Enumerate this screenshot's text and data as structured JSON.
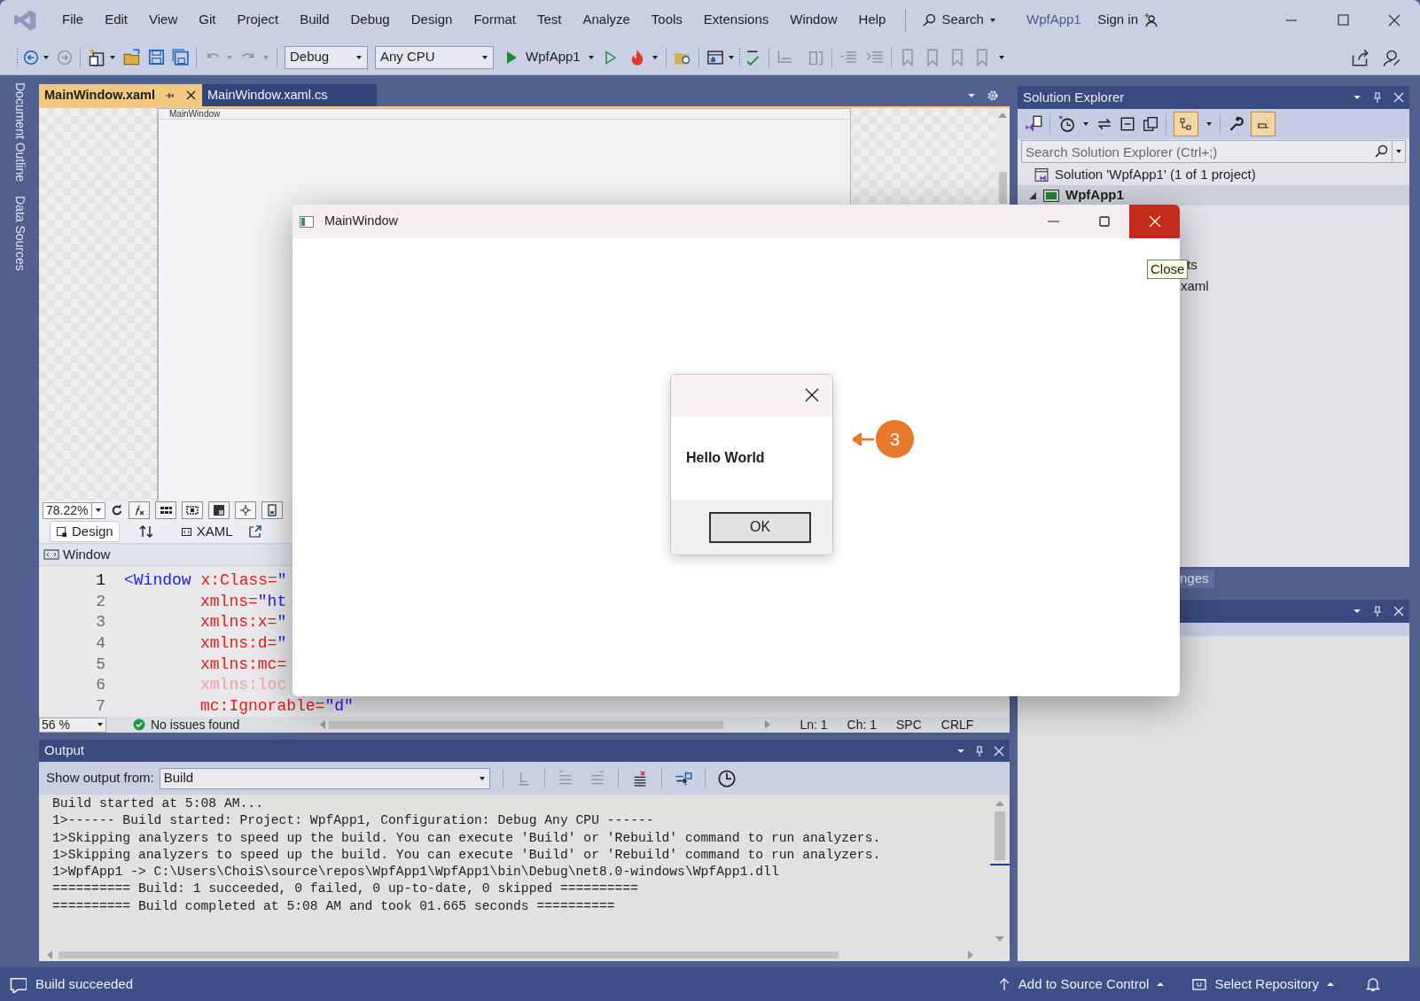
{
  "title_bar": {
    "menus": [
      "File",
      "Edit",
      "View",
      "Git",
      "Project",
      "Build",
      "Debug",
      "Design",
      "Format",
      "Test",
      "Analyze",
      "Tools",
      "Extensions",
      "Window",
      "Help"
    ],
    "search": "Search",
    "solution_name": "WpfApp1",
    "sign_in": "Sign in"
  },
  "toolbar": {
    "configuration": "Debug",
    "platform": "Any CPU",
    "start_target": "WpfApp1"
  },
  "side_tabs": [
    "Document Outline",
    "Data Sources"
  ],
  "document_tabs": [
    {
      "label": "MainWindow.xaml",
      "selected": true
    },
    {
      "label": "MainWindow.xaml.cs",
      "selected": false
    }
  ],
  "designer": {
    "frame_title": "MainWindow",
    "zoom": "78.22%",
    "view_tabs": [
      {
        "label": "Design",
        "selected": true
      },
      {
        "label": "XAML",
        "selected": false
      }
    ],
    "breadcrumb": "Window"
  },
  "code": {
    "lines": [
      {
        "number": "1",
        "current": true,
        "indented": false,
        "tokens": [
          {
            "kind": "tag",
            "text": "<Window"
          },
          {
            "kind": "attribute",
            "text": " x:Class="
          },
          {
            "kind": "value",
            "text": "\""
          }
        ]
      },
      {
        "number": "2",
        "current": false,
        "indented": true,
        "tokens": [
          {
            "kind": "attribute",
            "text": "xmlns="
          },
          {
            "kind": "value",
            "text": "\"ht"
          }
        ]
      },
      {
        "number": "3",
        "current": false,
        "indented": true,
        "tokens": [
          {
            "kind": "attribute",
            "text": "xmlns:x="
          },
          {
            "kind": "value",
            "text": "\""
          }
        ]
      },
      {
        "number": "4",
        "current": false,
        "indented": true,
        "tokens": [
          {
            "kind": "attribute",
            "text": "xmlns:d="
          },
          {
            "kind": "value",
            "text": "\""
          }
        ]
      },
      {
        "number": "5",
        "current": false,
        "indented": true,
        "tokens": [
          {
            "kind": "attribute",
            "text": "xmlns:mc="
          }
        ]
      },
      {
        "number": "6",
        "current": false,
        "indented": true,
        "tokens": [
          {
            "kind": "faded",
            "text": "xmlns:loc"
          }
        ]
      },
      {
        "number": "7",
        "current": false,
        "indented": true,
        "tokens": [
          {
            "kind": "attribute",
            "text": "mc:Ignorable="
          },
          {
            "kind": "value",
            "text": "\"d\""
          }
        ]
      }
    ]
  },
  "editor_status": {
    "zoom": "56 %",
    "issues": "No issues found",
    "line": "Ln: 1",
    "column": "Ch: 1",
    "whitespace": "SPC",
    "line_ending": "CRLF"
  },
  "output": {
    "title": "Output",
    "source_label": "Show output from:",
    "source": "Build",
    "lines": [
      "Build started at 5:08 AM...",
      "1>------ Build started: Project: WpfApp1, Configuration: Debug Any CPU ------",
      "1>Skipping analyzers to speed up the build. You can execute 'Build' or 'Rebuild' command to run analyzers.",
      "1>Skipping analyzers to speed up the build. You can execute 'Build' or 'Rebuild' command to run analyzers.",
      "1>WpfApp1 -> C:\\Users\\ChoiS\\source\\repos\\WpfApp1\\WpfApp1\\bin\\Debug\\net8.0-windows\\WpfApp1.dll",
      "========== Build: 1 succeeded, 0 failed, 0 up-to-date, 0 skipped ==========",
      "========== Build completed at 5:08 AM and took 01.665 seconds =========="
    ]
  },
  "solution_explorer": {
    "title": "Solution Explorer",
    "search_placeholder": "Search Solution Explorer (Ctrl+;)",
    "tree": [
      {
        "kind": "solution",
        "label": "Solution 'WpfApp1' (1 of 1 project)",
        "selected": false
      },
      {
        "kind": "project",
        "label": "WpfApp1",
        "selected": true,
        "expanded": true,
        "children": [
          {
            "kind": "fragment",
            "label": "ts"
          },
          {
            "kind": "fragment",
            "label": "xaml"
          }
        ]
      }
    ]
  },
  "lower_tab": "nges",
  "app_window": {
    "title": "MainWindow",
    "tooltip": "Close",
    "message_box": {
      "message": "Hello World",
      "button": "OK"
    }
  },
  "callout": "3",
  "status_bar": {
    "message": "Build succeeded",
    "source_control": "Add to Source Control",
    "repository": "Select Repository"
  }
}
